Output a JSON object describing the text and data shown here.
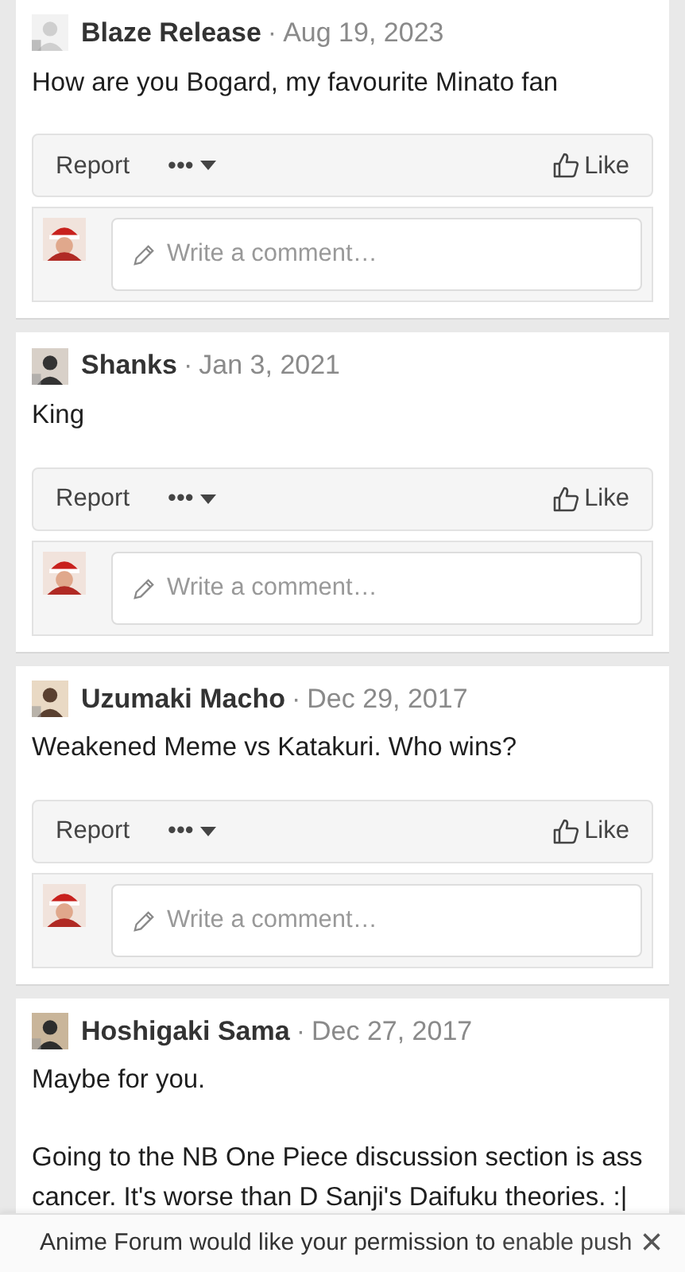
{
  "posts": [
    {
      "user": "Blaze Release",
      "separator": "·",
      "date": "Aug 19, 2023",
      "body": [
        "How are you Bogard, my favourite Minato fan"
      ],
      "actions": {
        "report": "Report",
        "more": "•••",
        "like": "Like"
      },
      "comment_placeholder": "Write a comment…"
    },
    {
      "user": "Shanks",
      "separator": "·",
      "date": "Jan 3, 2021",
      "body": [
        "King"
      ],
      "actions": {
        "report": "Report",
        "more": "•••",
        "like": "Like"
      },
      "comment_placeholder": "Write a comment…"
    },
    {
      "user": "Uzumaki Macho",
      "separator": "·",
      "date": "Dec 29, 2017",
      "body": [
        "Weakened Meme vs Katakuri. Who wins?"
      ],
      "actions": {
        "report": "Report",
        "more": "•••",
        "like": "Like"
      },
      "comment_placeholder": "Write a comment…"
    },
    {
      "user": "Hoshigaki Sama",
      "separator": "·",
      "date": "Dec 27, 2017",
      "body": [
        "Maybe for you.",
        "Going to the NB One Piece discussion section is ass cancer. It's worse than D Sanji's Daifuku theories. :|"
      ]
    }
  ],
  "banner": {
    "text": "Anime Forum would like your permission to",
    "link": "enable push",
    "close": "×"
  }
}
